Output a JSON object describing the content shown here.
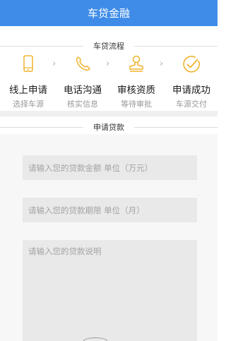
{
  "header": {
    "title": "车贷金融"
  },
  "process": {
    "label": "车贷流程",
    "steps": [
      {
        "icon": "phone-icon",
        "title": "线上申请",
        "sub": "选择车源"
      },
      {
        "icon": "call-icon",
        "title": "电话沟通",
        "sub": "核实信息"
      },
      {
        "icon": "stamp-icon",
        "title": "审核资质",
        "sub": "等待审批"
      },
      {
        "icon": "check-circle-icon",
        "title": "申请成功",
        "sub": "车源交付"
      }
    ],
    "accent_color": "#f0b330"
  },
  "loan": {
    "label": "申请贷款",
    "amount_placeholder": "请输入您的贷款金额 单位（万元）",
    "term_placeholder": "请输入您的贷款期限 单位（月）",
    "desc_placeholder": "请输入您的贷款说明"
  },
  "colors": {
    "header_bg": "#3f8ce8"
  }
}
